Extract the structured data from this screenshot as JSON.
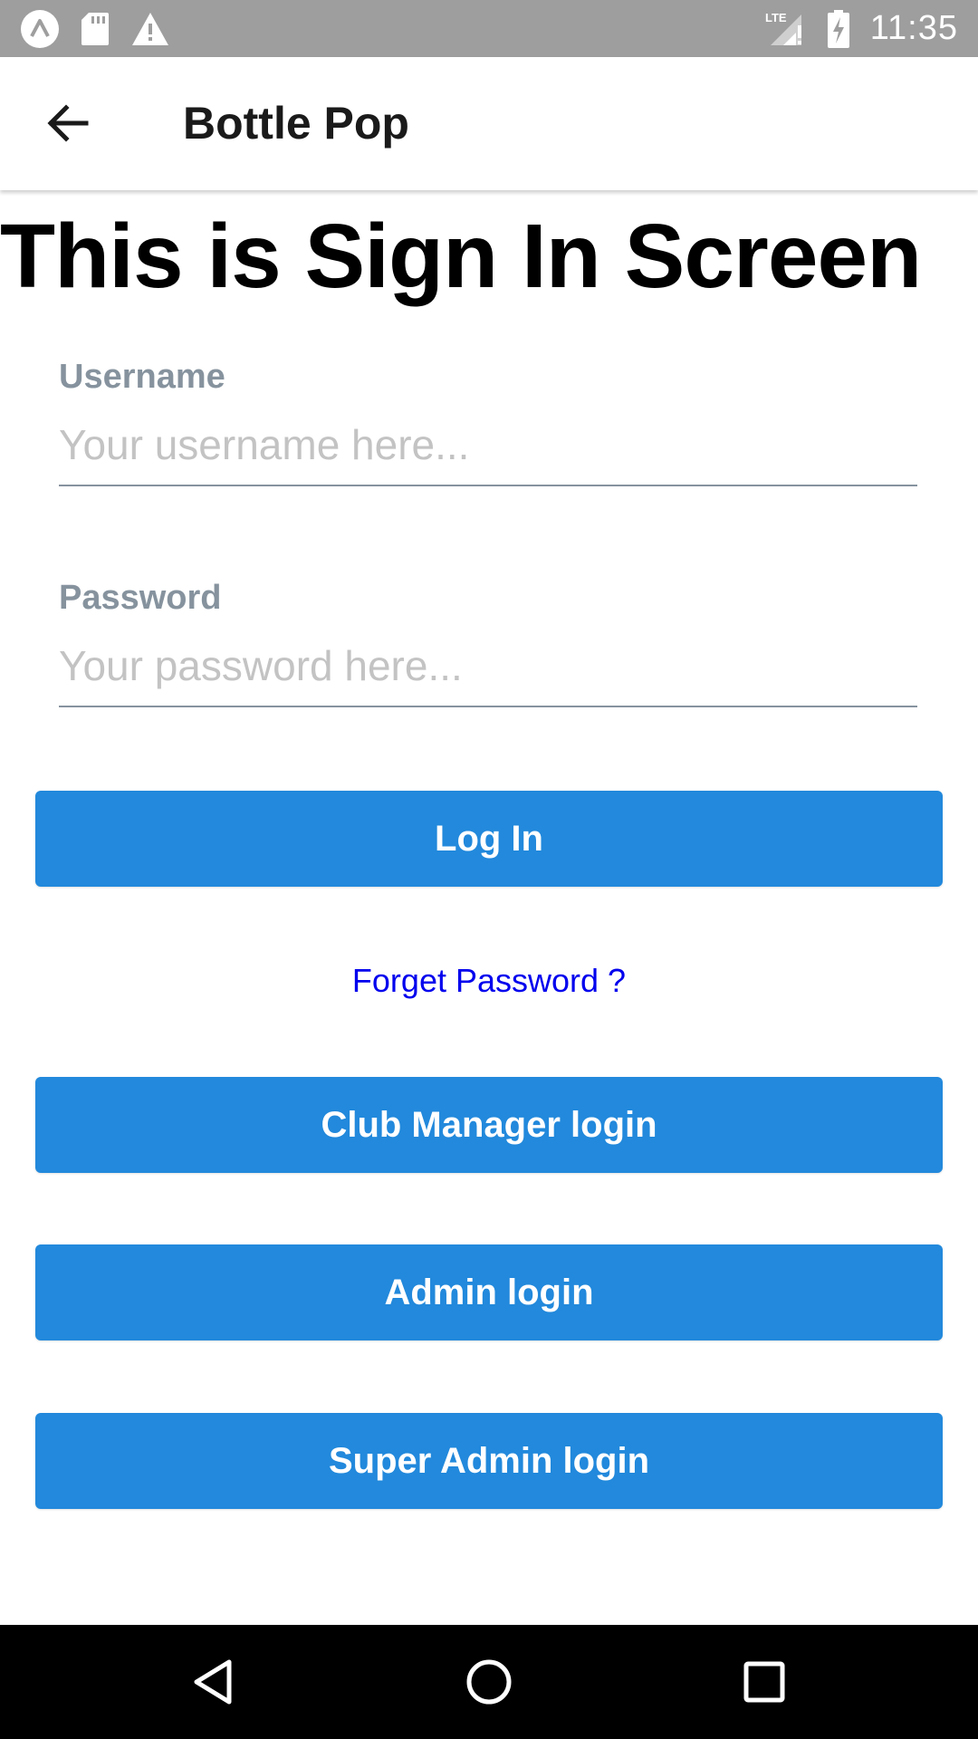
{
  "status_bar": {
    "time": "11:35",
    "network": "LTE",
    "left_icons": [
      "expo-icon",
      "sd-card-icon",
      "warning-icon"
    ],
    "right_icons": [
      "signal-icon",
      "battery-charging-icon"
    ]
  },
  "app_bar": {
    "title": "Bottle Pop",
    "back_icon": "arrow-left-icon"
  },
  "main": {
    "heading": "This is Sign In Screen",
    "username": {
      "label": "Username",
      "placeholder": "Your username here...",
      "value": ""
    },
    "password": {
      "label": "Password",
      "placeholder": "Your password here...",
      "value": ""
    },
    "login_button": "Log In",
    "forgot_link": "Forget Password ?",
    "club_manager_button": "Club Manager login",
    "admin_button": "Admin login",
    "super_admin_button": "Super Admin login"
  },
  "nav_bar": {
    "icons": [
      "back-triangle-icon",
      "home-circle-icon",
      "recents-square-icon"
    ]
  },
  "colors": {
    "status_bar": "#9e9e9e",
    "primary_button": "#2289dc",
    "label": "#86939e",
    "link": "#0000ee",
    "nav_bar": "#000000"
  }
}
